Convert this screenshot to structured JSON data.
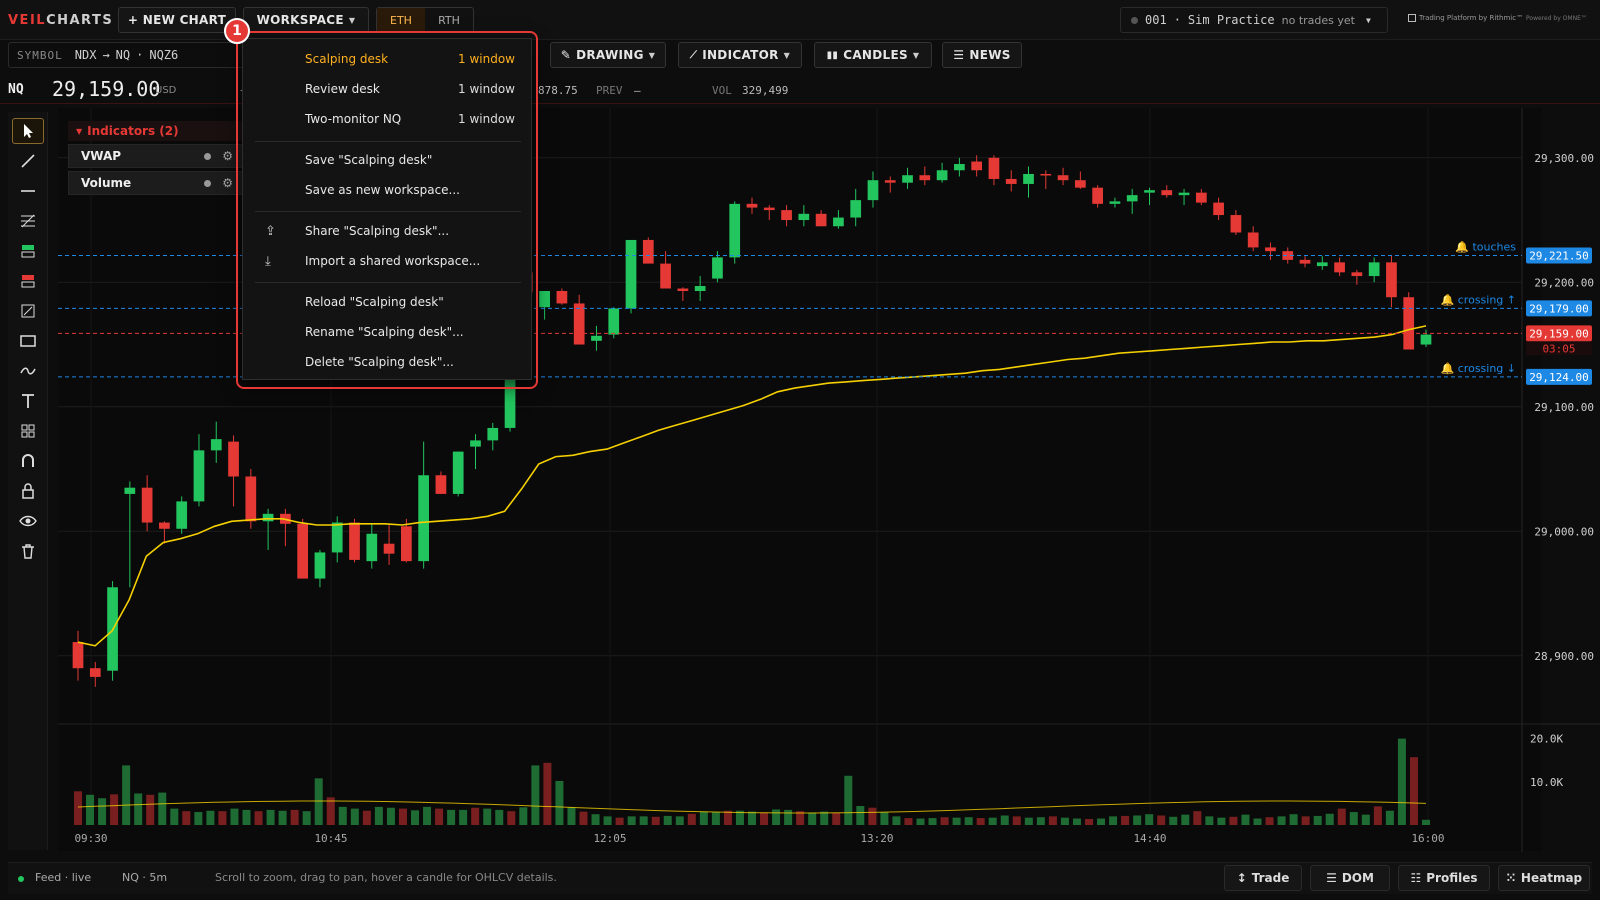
{
  "brand": {
    "part1": "VEIL",
    "part2": "CHARTS"
  },
  "toolbar": {
    "new_chart": "+ NEW CHART",
    "workspace": "WORKSPACE",
    "session_eth": "ETH",
    "session_rth": "RTH",
    "drawing": "DRAWING",
    "indicator": "INDICATOR",
    "candles": "CANDLES",
    "news": "NEWS"
  },
  "account": {
    "id": "001",
    "name": "Sim Practice",
    "note": "no trades yet",
    "dot_color": "#555555"
  },
  "powered": {
    "rithmic": "Trading Platform by Rithmic™",
    "omne": "Powered by OMNE™"
  },
  "symbol": {
    "label": "SYMBOL",
    "root": "NDX",
    "arrow": "→",
    "product": "NQ",
    "dot": "·",
    "contract": "NQZ6"
  },
  "quote": {
    "sym": "NQ",
    "price": "29,159.00",
    "ccy": "USD",
    "dash": "—",
    "low_partial": "878.75",
    "prev_label": "PREV",
    "prev_val": "—",
    "vol_label": "VOL",
    "vol_val": "329,499"
  },
  "indicators": {
    "header": "Indicators (2)",
    "items": [
      "VWAP",
      "Volume"
    ]
  },
  "menu": {
    "badge": "1",
    "items": [
      {
        "label": "Scalping desk",
        "right": "1 window",
        "active": true
      },
      {
        "label": "Review desk",
        "right": "1 window"
      },
      {
        "label": "Two-monitor NQ",
        "right": "1 window"
      },
      {
        "label": "Save \"Scalping desk\""
      },
      {
        "label": "Save as new workspace..."
      },
      {
        "label": "Share \"Scalping desk\"...",
        "icon": "share-icon"
      },
      {
        "label": "Import a shared workspace...",
        "icon": "import-icon"
      },
      {
        "label": "Reload \"Scalping desk\""
      },
      {
        "label": "Rename \"Scalping desk\"..."
      },
      {
        "label": "Delete \"Scalping desk\"..."
      }
    ]
  },
  "status": {
    "feed": "Feed · live",
    "chart": "NQ · 5m",
    "hint": "Scroll to zoom, drag to pan, hover a candle for OHLCV details.",
    "trade": "Trade",
    "dom": "DOM",
    "profiles": "Profiles",
    "heatmap": "Heatmap"
  },
  "colors": {
    "up": "#22c55e",
    "down": "#e53935",
    "vwap": "#f5d000",
    "alert": "#1e88e5",
    "accent": "#ffb020"
  },
  "chart_data": {
    "type": "candlestick",
    "interval": "5m",
    "price_axis": {
      "ticks": [
        28900,
        29000,
        29100,
        29200,
        29300
      ],
      "tick_labels": [
        "28,900.00",
        "29,000.00",
        "29,100.00",
        "29,200.00",
        "29,300.00"
      ],
      "ylim": [
        28850,
        29340
      ]
    },
    "volume_axis": {
      "tick_labels": [
        "20.0K",
        "10.0K"
      ],
      "ticks": [
        20000,
        10000
      ],
      "ylim": [
        0,
        22000
      ]
    },
    "time_labels": [
      "09:30",
      "10:45",
      "12:05",
      "13:20",
      "14:40",
      "16:00"
    ],
    "last_price": {
      "value": 29159,
      "label": "29,159.00",
      "countdown": "03:05"
    },
    "alerts": [
      {
        "price": 29221.5,
        "label": "29,221.50",
        "text": "touches"
      },
      {
        "price": 29179,
        "label": "29,179.00",
        "text": "crossing ↑"
      },
      {
        "price": 29124,
        "label": "29,124.00",
        "text": "crossing ↓"
      }
    ],
    "candles": [
      [
        28911,
        28920,
        28880,
        28890
      ],
      [
        28890,
        28895,
        28875,
        28883
      ],
      [
        28888,
        28960,
        28880,
        28955
      ],
      [
        29030,
        29040,
        28955,
        29035
      ],
      [
        29035,
        29045,
        29000,
        29007
      ],
      [
        29007,
        29008,
        28990,
        29002
      ],
      [
        29002,
        29028,
        28998,
        29024
      ],
      [
        29024,
        29078,
        29020,
        29065
      ],
      [
        29065,
        29088,
        29055,
        29074
      ],
      [
        29072,
        29077,
        29020,
        29044
      ],
      [
        29044,
        29050,
        29002,
        29008
      ],
      [
        29008,
        29018,
        28985,
        29014
      ],
      [
        29014,
        29018,
        28988,
        29006
      ],
      [
        29006,
        29010,
        28962,
        28962
      ],
      [
        28962,
        28985,
        28955,
        28983
      ],
      [
        28983,
        29012,
        28975,
        29007
      ],
      [
        29007,
        29010,
        28975,
        28977
      ],
      [
        28976,
        29006,
        28970,
        28998
      ],
      [
        28990,
        29006,
        28973,
        28982
      ],
      [
        29004,
        29010,
        28975,
        28976
      ],
      [
        28976,
        29072,
        28970,
        29045
      ],
      [
        29045,
        29048,
        29030,
        29030
      ],
      [
        29030,
        29064,
        29028,
        29064
      ],
      [
        29068,
        29078,
        29050,
        29073
      ],
      [
        29073,
        29087,
        29065,
        29083
      ],
      [
        29083,
        29135,
        29080,
        29133
      ],
      [
        29208,
        29212,
        29180,
        29192
      ],
      [
        29180,
        29193,
        29170,
        29193
      ],
      [
        29193,
        29195,
        29182,
        29183
      ],
      [
        29183,
        29190,
        29150,
        29150
      ],
      [
        29153,
        29165,
        29145,
        29157
      ],
      [
        29158,
        29180,
        29155,
        29179
      ],
      [
        29179,
        29230,
        29175,
        29234
      ],
      [
        29234,
        29236,
        29220,
        29215
      ],
      [
        29215,
        29225,
        29195,
        29195
      ],
      [
        29195,
        29196,
        29185,
        29193
      ],
      [
        29193,
        29205,
        29185,
        29197
      ],
      [
        29203,
        29225,
        29200,
        29220
      ],
      [
        29220,
        29265,
        29215,
        29263
      ],
      [
        29263,
        29268,
        29255,
        29260
      ],
      [
        29260,
        29262,
        29250,
        29258
      ],
      [
        29258,
        29262,
        29245,
        29250
      ],
      [
        29250,
        29262,
        29245,
        29255
      ],
      [
        29255,
        29258,
        29245,
        29245
      ],
      [
        29245,
        29258,
        29243,
        29252
      ],
      [
        29252,
        29275,
        29245,
        29266
      ],
      [
        29266,
        29289,
        29260,
        29282
      ],
      [
        29282,
        29285,
        29272,
        29280
      ],
      [
        29280,
        29292,
        29275,
        29286
      ],
      [
        29286,
        29293,
        29278,
        29282
      ],
      [
        29282,
        29296,
        29280,
        29290
      ],
      [
        29290,
        29300,
        29285,
        29295
      ],
      [
        29297,
        29302,
        29285,
        29290
      ],
      [
        29300,
        29302,
        29278,
        29283
      ],
      [
        29283,
        29290,
        29273,
        29279
      ],
      [
        29279,
        29293,
        29268,
        29287
      ],
      [
        29287,
        29290,
        29275,
        29286
      ],
      [
        29286,
        29292,
        29278,
        29282
      ],
      [
        29282,
        29289,
        29275,
        29276
      ],
      [
        29276,
        29278,
        29260,
        29263
      ],
      [
        29263,
        29268,
        29260,
        29265
      ],
      [
        29265,
        29275,
        29255,
        29270
      ],
      [
        29272,
        29276,
        29262,
        29274
      ],
      [
        29274,
        29278,
        29268,
        29270
      ],
      [
        29270,
        29275,
        29262,
        29272
      ],
      [
        29272,
        29275,
        29262,
        29264
      ],
      [
        29264,
        29268,
        29250,
        29254
      ],
      [
        29254,
        29258,
        29238,
        29240
      ],
      [
        29240,
        29245,
        29225,
        29228
      ],
      [
        29228,
        29232,
        29218,
        29225
      ],
      [
        29225,
        29228,
        29215,
        29218
      ],
      [
        29218,
        29221,
        29212,
        29215
      ],
      [
        29213,
        29221,
        29210,
        29216
      ],
      [
        29216,
        29220,
        29205,
        29208
      ],
      [
        29208,
        29210,
        29198,
        29205
      ],
      [
        29205,
        29220,
        29200,
        29216
      ],
      [
        29216,
        29222,
        29180,
        29188
      ],
      [
        29188,
        29192,
        29150,
        29146
      ],
      [
        29150,
        29162,
        29148,
        29158
      ]
    ],
    "volume": [
      7800,
      7000,
      6200,
      7100,
      13800,
      7300,
      7000,
      7500,
      3800,
      3200,
      3000,
      3300,
      3200,
      3800,
      3500,
      3200,
      3500,
      3300,
      3500,
      3200,
      10800,
      6400,
      4200,
      3800,
      3300,
      4200,
      4000,
      3800,
      3400,
      4200,
      3800,
      3500,
      3500,
      4000,
      3800,
      3500,
      3200,
      4100,
      13800,
      14400,
      10200,
      4100,
      3100,
      2500,
      2000,
      1700,
      2000,
      2000,
      1900,
      2100,
      2000,
      2600,
      3100,
      3000,
      3300,
      3300,
      3100,
      2900,
      3600,
      3500,
      3200,
      2900,
      3100,
      2800,
      11400,
      4400,
      4000,
      3000,
      2000,
      1600,
      1500,
      1600,
      1800,
      1700,
      1800,
      1600,
      1700,
      2200,
      2000,
      1700,
      1800,
      2000,
      1700,
      1500,
      1400,
      1500,
      2000,
      2100,
      2200,
      2500,
      2200,
      1900,
      2400,
      3200,
      2000,
      1700,
      1900,
      2400,
      1500,
      1800,
      2000,
      2500,
      2000,
      2100,
      2600,
      3800,
      3000,
      2400,
      4300,
      3300,
      20000,
      15700,
      1200
    ],
    "vwap": [
      28911,
      28908,
      28920,
      28945,
      28980,
      28991,
      28994,
      28998,
      29004,
      29008,
      29009,
      29010,
      29010,
      29007,
      29005,
      29005,
      29006,
      29006,
      29006,
      29005,
      29007,
      29008,
      29009,
      29010,
      29012,
      29016,
      29034,
      29054,
      29060,
      29061,
      29064,
      29066,
      29071,
      29076,
      29081,
      29085,
      29089,
      29093,
      29097,
      29101,
      29106,
      29112,
      29115,
      29117,
      29119,
      29120,
      29121,
      29122,
      29123,
      29124,
      29125,
      29126,
      29127,
      29129,
      29130,
      29132,
      29134,
      29136,
      29138,
      29139,
      29141,
      29143,
      29144,
      29145,
      29146,
      29147,
      29148,
      29149,
      29150,
      29151,
      29152,
      29152,
      29153,
      29153,
      29154,
      29155,
      29156,
      29158,
      29162,
      29165
    ]
  }
}
